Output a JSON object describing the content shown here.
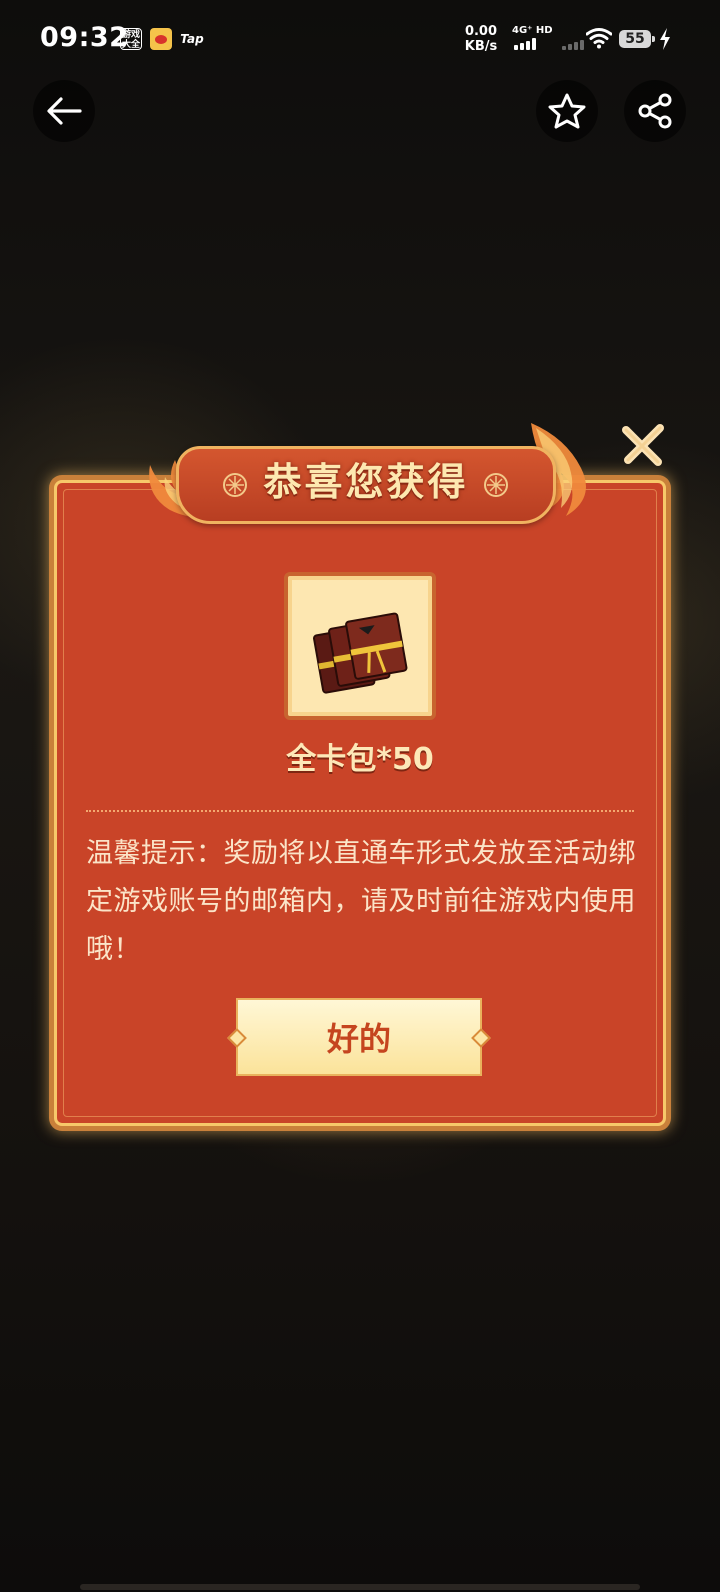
{
  "status_bar": {
    "time": "09:32",
    "app_icons": {
      "youxi": "游戏\n大全",
      "tap": "Tap"
    },
    "net_speed_value": "0.00",
    "net_speed_unit": "KB/s",
    "net_type": "4G⁺ HD",
    "battery": "55"
  },
  "nav": {
    "back_icon": "arrow-left-icon",
    "favorite_icon": "star-icon",
    "share_icon": "share-icon"
  },
  "dialog": {
    "title": "恭喜您获得",
    "reward_name": "全卡包*50",
    "tip": "温馨提示：奖励将以直通车形式发放至活动绑定游戏账号的邮箱内，请及时前往游戏内使用哦！",
    "ok_label": "好的",
    "close_icon": "close-icon"
  },
  "colors": {
    "dialog_bg": "#c94428",
    "gold_border": "#f7c86a",
    "button_text": "#c5451f"
  }
}
